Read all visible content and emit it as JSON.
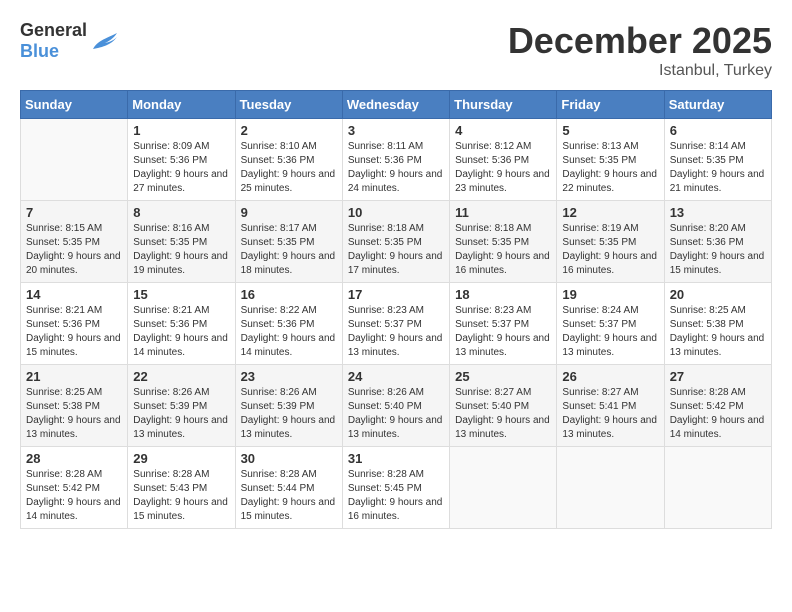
{
  "logo": {
    "general": "General",
    "blue": "Blue"
  },
  "title": "December 2025",
  "subtitle": "Istanbul, Turkey",
  "days_of_week": [
    "Sunday",
    "Monday",
    "Tuesday",
    "Wednesday",
    "Thursday",
    "Friday",
    "Saturday"
  ],
  "weeks": [
    [
      {
        "day": "",
        "sunrise": "",
        "sunset": "",
        "daylight": ""
      },
      {
        "day": "1",
        "sunrise": "Sunrise: 8:09 AM",
        "sunset": "Sunset: 5:36 PM",
        "daylight": "Daylight: 9 hours and 27 minutes."
      },
      {
        "day": "2",
        "sunrise": "Sunrise: 8:10 AM",
        "sunset": "Sunset: 5:36 PM",
        "daylight": "Daylight: 9 hours and 25 minutes."
      },
      {
        "day": "3",
        "sunrise": "Sunrise: 8:11 AM",
        "sunset": "Sunset: 5:36 PM",
        "daylight": "Daylight: 9 hours and 24 minutes."
      },
      {
        "day": "4",
        "sunrise": "Sunrise: 8:12 AM",
        "sunset": "Sunset: 5:36 PM",
        "daylight": "Daylight: 9 hours and 23 minutes."
      },
      {
        "day": "5",
        "sunrise": "Sunrise: 8:13 AM",
        "sunset": "Sunset: 5:35 PM",
        "daylight": "Daylight: 9 hours and 22 minutes."
      },
      {
        "day": "6",
        "sunrise": "Sunrise: 8:14 AM",
        "sunset": "Sunset: 5:35 PM",
        "daylight": "Daylight: 9 hours and 21 minutes."
      }
    ],
    [
      {
        "day": "7",
        "sunrise": "Sunrise: 8:15 AM",
        "sunset": "Sunset: 5:35 PM",
        "daylight": "Daylight: 9 hours and 20 minutes."
      },
      {
        "day": "8",
        "sunrise": "Sunrise: 8:16 AM",
        "sunset": "Sunset: 5:35 PM",
        "daylight": "Daylight: 9 hours and 19 minutes."
      },
      {
        "day": "9",
        "sunrise": "Sunrise: 8:17 AM",
        "sunset": "Sunset: 5:35 PM",
        "daylight": "Daylight: 9 hours and 18 minutes."
      },
      {
        "day": "10",
        "sunrise": "Sunrise: 8:18 AM",
        "sunset": "Sunset: 5:35 PM",
        "daylight": "Daylight: 9 hours and 17 minutes."
      },
      {
        "day": "11",
        "sunrise": "Sunrise: 8:18 AM",
        "sunset": "Sunset: 5:35 PM",
        "daylight": "Daylight: 9 hours and 16 minutes."
      },
      {
        "day": "12",
        "sunrise": "Sunrise: 8:19 AM",
        "sunset": "Sunset: 5:35 PM",
        "daylight": "Daylight: 9 hours and 16 minutes."
      },
      {
        "day": "13",
        "sunrise": "Sunrise: 8:20 AM",
        "sunset": "Sunset: 5:36 PM",
        "daylight": "Daylight: 9 hours and 15 minutes."
      }
    ],
    [
      {
        "day": "14",
        "sunrise": "Sunrise: 8:21 AM",
        "sunset": "Sunset: 5:36 PM",
        "daylight": "Daylight: 9 hours and 15 minutes."
      },
      {
        "day": "15",
        "sunrise": "Sunrise: 8:21 AM",
        "sunset": "Sunset: 5:36 PM",
        "daylight": "Daylight: 9 hours and 14 minutes."
      },
      {
        "day": "16",
        "sunrise": "Sunrise: 8:22 AM",
        "sunset": "Sunset: 5:36 PM",
        "daylight": "Daylight: 9 hours and 14 minutes."
      },
      {
        "day": "17",
        "sunrise": "Sunrise: 8:23 AM",
        "sunset": "Sunset: 5:37 PM",
        "daylight": "Daylight: 9 hours and 13 minutes."
      },
      {
        "day": "18",
        "sunrise": "Sunrise: 8:23 AM",
        "sunset": "Sunset: 5:37 PM",
        "daylight": "Daylight: 9 hours and 13 minutes."
      },
      {
        "day": "19",
        "sunrise": "Sunrise: 8:24 AM",
        "sunset": "Sunset: 5:37 PM",
        "daylight": "Daylight: 9 hours and 13 minutes."
      },
      {
        "day": "20",
        "sunrise": "Sunrise: 8:25 AM",
        "sunset": "Sunset: 5:38 PM",
        "daylight": "Daylight: 9 hours and 13 minutes."
      }
    ],
    [
      {
        "day": "21",
        "sunrise": "Sunrise: 8:25 AM",
        "sunset": "Sunset: 5:38 PM",
        "daylight": "Daylight: 9 hours and 13 minutes."
      },
      {
        "day": "22",
        "sunrise": "Sunrise: 8:26 AM",
        "sunset": "Sunset: 5:39 PM",
        "daylight": "Daylight: 9 hours and 13 minutes."
      },
      {
        "day": "23",
        "sunrise": "Sunrise: 8:26 AM",
        "sunset": "Sunset: 5:39 PM",
        "daylight": "Daylight: 9 hours and 13 minutes."
      },
      {
        "day": "24",
        "sunrise": "Sunrise: 8:26 AM",
        "sunset": "Sunset: 5:40 PM",
        "daylight": "Daylight: 9 hours and 13 minutes."
      },
      {
        "day": "25",
        "sunrise": "Sunrise: 8:27 AM",
        "sunset": "Sunset: 5:40 PM",
        "daylight": "Daylight: 9 hours and 13 minutes."
      },
      {
        "day": "26",
        "sunrise": "Sunrise: 8:27 AM",
        "sunset": "Sunset: 5:41 PM",
        "daylight": "Daylight: 9 hours and 13 minutes."
      },
      {
        "day": "27",
        "sunrise": "Sunrise: 8:28 AM",
        "sunset": "Sunset: 5:42 PM",
        "daylight": "Daylight: 9 hours and 14 minutes."
      }
    ],
    [
      {
        "day": "28",
        "sunrise": "Sunrise: 8:28 AM",
        "sunset": "Sunset: 5:42 PM",
        "daylight": "Daylight: 9 hours and 14 minutes."
      },
      {
        "day": "29",
        "sunrise": "Sunrise: 8:28 AM",
        "sunset": "Sunset: 5:43 PM",
        "daylight": "Daylight: 9 hours and 15 minutes."
      },
      {
        "day": "30",
        "sunrise": "Sunrise: 8:28 AM",
        "sunset": "Sunset: 5:44 PM",
        "daylight": "Daylight: 9 hours and 15 minutes."
      },
      {
        "day": "31",
        "sunrise": "Sunrise: 8:28 AM",
        "sunset": "Sunset: 5:45 PM",
        "daylight": "Daylight: 9 hours and 16 minutes."
      },
      {
        "day": "",
        "sunrise": "",
        "sunset": "",
        "daylight": ""
      },
      {
        "day": "",
        "sunrise": "",
        "sunset": "",
        "daylight": ""
      },
      {
        "day": "",
        "sunrise": "",
        "sunset": "",
        "daylight": ""
      }
    ]
  ]
}
